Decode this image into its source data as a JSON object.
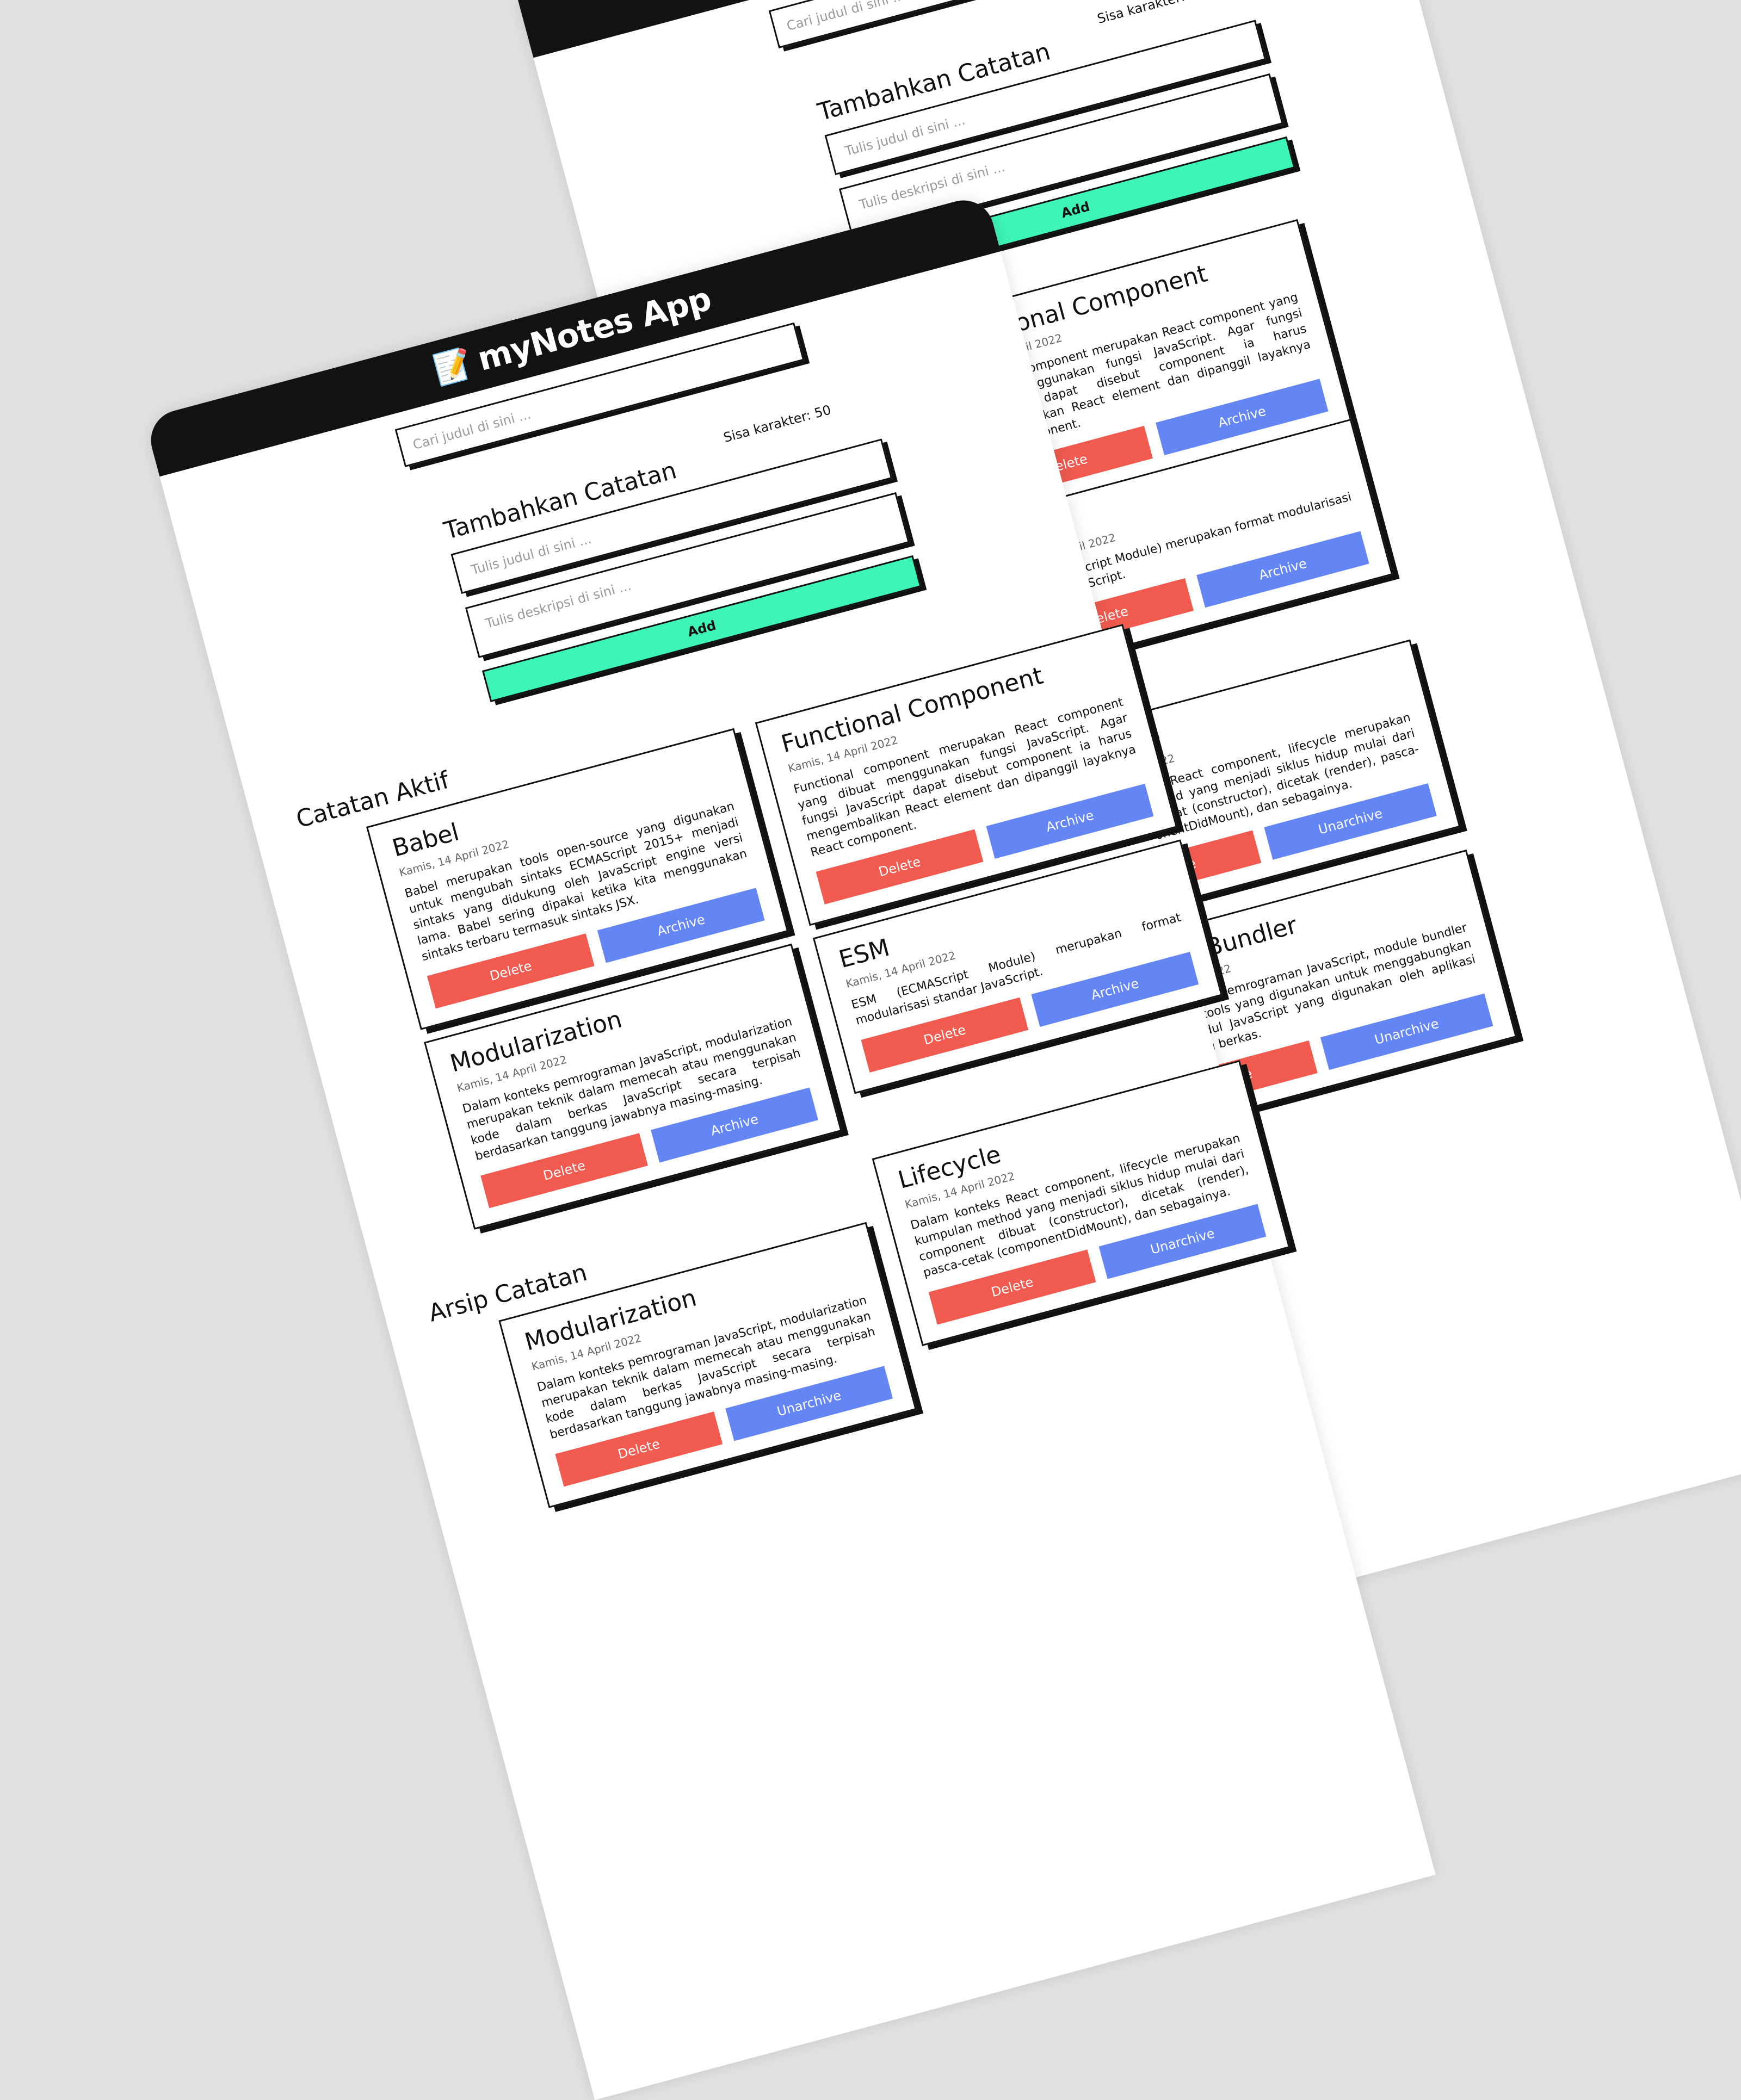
{
  "header": {
    "logo_icon": "📝",
    "title": "myNotes App"
  },
  "search": {
    "placeholder": "Cari judul di sini ..."
  },
  "form": {
    "title": "Tambahkan Catatan",
    "counter": "Sisa karakter: 50",
    "title_placeholder": "Tulis judul di sini ...",
    "body_placeholder": "Tulis deskripsi di sini ...",
    "add_label": "Add"
  },
  "sections": {
    "active": "Catatan Aktif",
    "archive": "Arsip Catatan"
  },
  "buttons": {
    "delete": "Delete",
    "archive": "Archive",
    "unarchive": "Unarchive"
  },
  "notes": [
    {
      "title": "Babel",
      "date": "Kamis, 14 April 2022",
      "body": "Babel merupakan tools open-source yang digunakan untuk mengubah sintaks ECMAScript 2015+ menjadi sintaks yang didukung oleh JavaScript engine versi lama. Babel sering dipakai ketika kita menggunakan sintaks terbaru termasuk sintaks JSX."
    },
    {
      "title": "Functional Component",
      "date": "Kamis, 14 April 2022",
      "body": "Functional component merupakan React component yang dibuat menggunakan fungsi JavaScript. Agar fungsi JavaScript dapat disebut component ia harus mengembalikan React element dan dipanggil layaknya React component."
    },
    {
      "title": "Modularization",
      "date": "Kamis, 14 April 2022",
      "body": "Dalam konteks pemrograman JavaScript, modularization merupakan teknik dalam memecah atau menggunakan kode dalam berkas JavaScript secara terpisah berdasarkan tanggung jawabnya masing-masing."
    },
    {
      "title": "ESM",
      "date": "Kamis, 14 April 2022",
      "body": "ESM (ECMAScript Module) merupakan format modularisasi standar JavaScript."
    },
    {
      "title": "Lifecycle",
      "date": "Kamis, 14 April 2022",
      "body": "Dalam konteks React component, lifecycle merupakan kumpulan method yang menjadi siklus hidup mulai dari component dibuat (constructor), dicetak (render), pasca-cetak (componentDidMount), dan sebagainya."
    },
    {
      "title": "Module Bundler",
      "date": "Kamis, 14 April 2022",
      "body": "Dalam konteks pemrograman JavaScript, module bundler merupakan tools yang digunakan untuk menggabungkan seluruh modul JavaScript yang digunakan oleh aplikasi menjadi satu berkas."
    }
  ],
  "colors": {
    "header": "#121212",
    "add": "#3cf5b6",
    "delete": "#f05a4f",
    "archive": "#6486f5",
    "background": "#e2e2e2"
  }
}
